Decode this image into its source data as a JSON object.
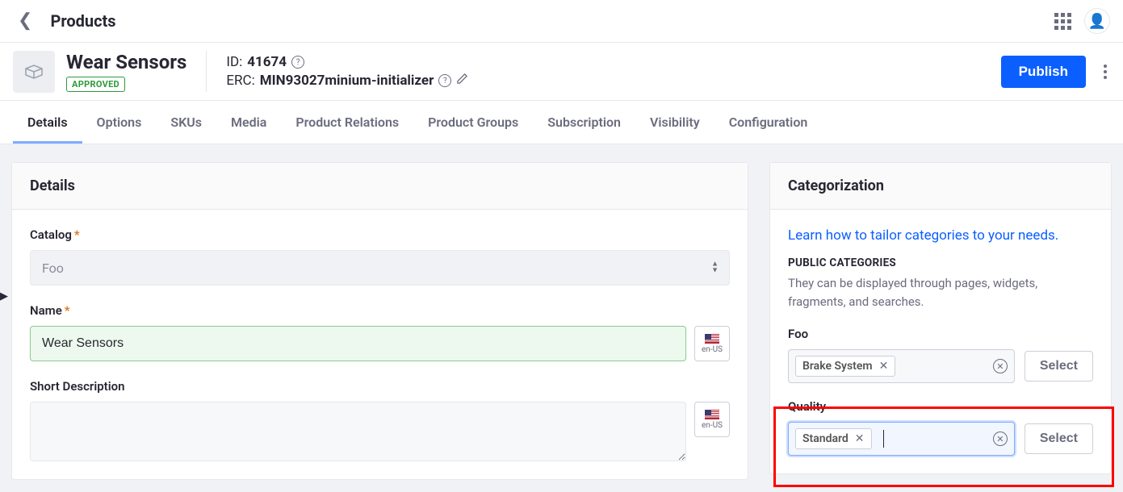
{
  "topbar": {
    "title": "Products"
  },
  "product": {
    "name": "Wear Sensors",
    "status": "APPROVED",
    "id_label": "ID:",
    "id_value": "41674",
    "erc_label": "ERC:",
    "erc_value": "MIN93027minium-initializer"
  },
  "actions": {
    "publish": "Publish"
  },
  "tabs": [
    "Details",
    "Options",
    "SKUs",
    "Media",
    "Product Relations",
    "Product Groups",
    "Subscription",
    "Visibility",
    "Configuration"
  ],
  "details_panel": {
    "heading": "Details",
    "catalog_label": "Catalog",
    "catalog_value": "Foo",
    "name_label": "Name",
    "name_value": "Wear Sensors",
    "short_desc_label": "Short Description",
    "lang": "en-US"
  },
  "categorization_panel": {
    "heading": "Categorization",
    "learn_link": "Learn how to tailor categories to your needs.",
    "public_label": "PUBLIC CATEGORIES",
    "public_desc": "They can be displayed through pages, widgets, fragments, and searches.",
    "vocab1_label": "Foo",
    "vocab1_chip": "Brake System",
    "vocab2_label": "Quality",
    "vocab2_chip": "Standard",
    "select_btn": "Select"
  }
}
